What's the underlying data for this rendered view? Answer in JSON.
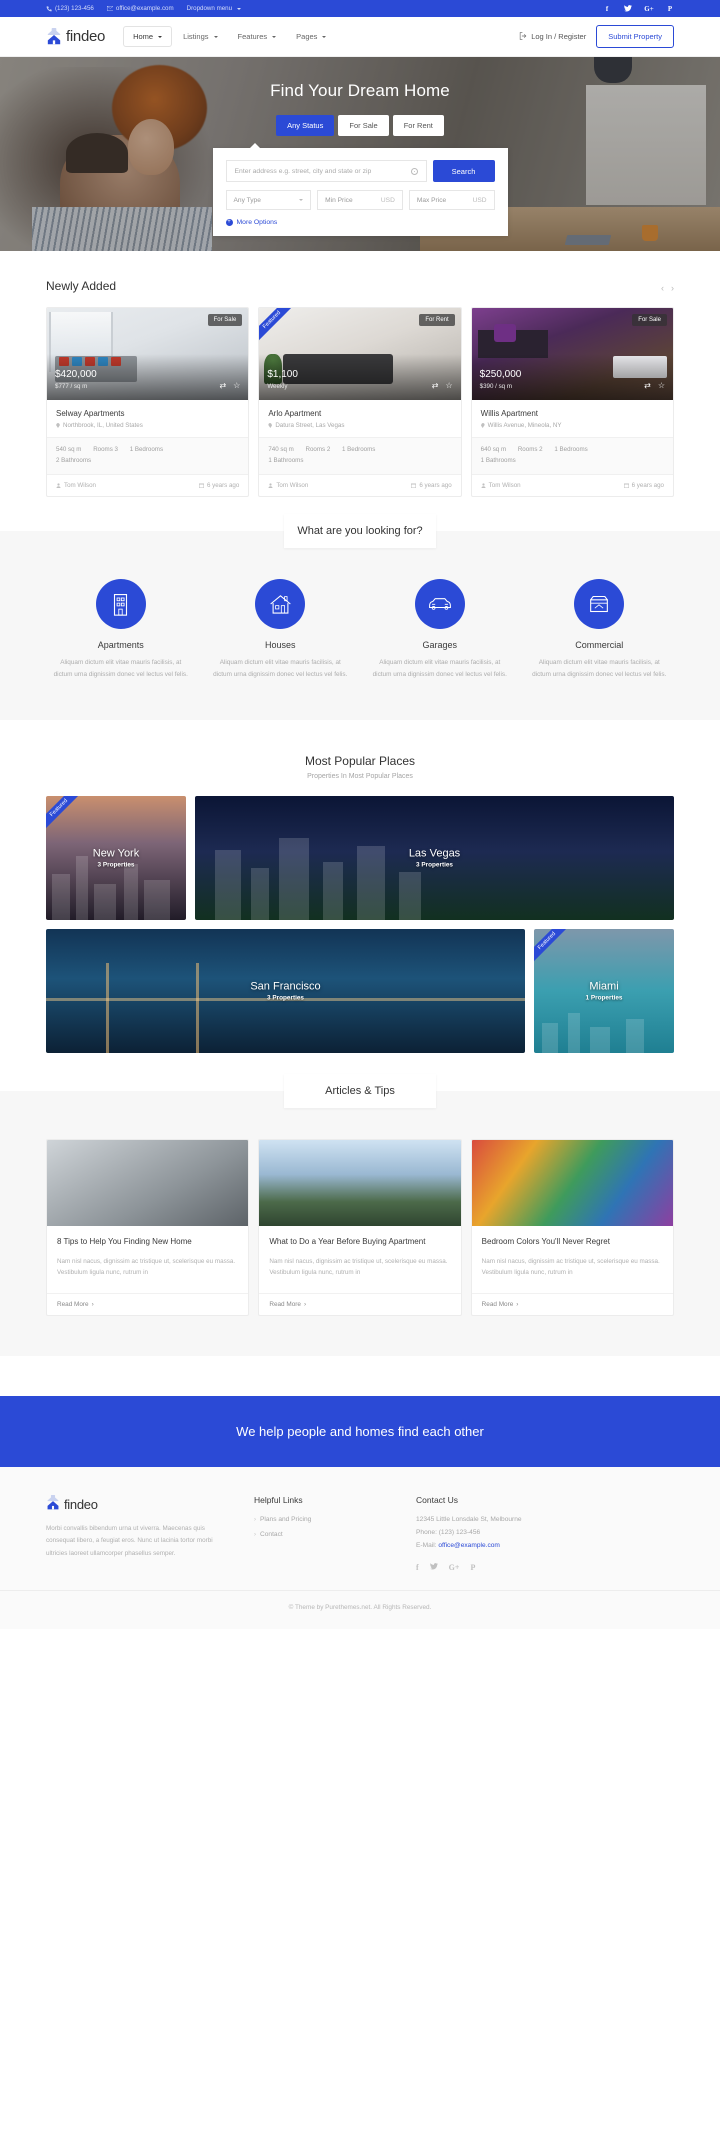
{
  "topbar": {
    "phone": "(123) 123-456",
    "email": "office@example.com",
    "dropdown": "Dropdown menu",
    "socials": [
      "facebook-icon",
      "twitter-icon",
      "google-plus-icon",
      "pinterest-icon"
    ]
  },
  "header": {
    "brand": "findeo",
    "nav": [
      {
        "label": "Home",
        "active": true
      },
      {
        "label": "Listings",
        "active": false
      },
      {
        "label": "Features",
        "active": false
      },
      {
        "label": "Pages",
        "active": false
      }
    ],
    "login": "Log In / Register",
    "submit": "Submit Property"
  },
  "hero": {
    "title": "Find Your Dream Home",
    "status_tabs": [
      {
        "label": "Any Status",
        "active": true
      },
      {
        "label": "For Sale",
        "active": false
      },
      {
        "label": "For Rent",
        "active": false
      }
    ],
    "search": {
      "placeholder": "Enter address e.g. street, city and state or zip",
      "value": "",
      "button": "Search",
      "type_select": "Any Type",
      "min_price": "Min Price",
      "min_unit": "USD",
      "max_price": "Max Price",
      "max_unit": "USD",
      "more_options": "More Options"
    }
  },
  "newly_added": {
    "title": "Newly Added",
    "properties": [
      {
        "name": "Selway Apartments",
        "address": "Northbrook, IL, United States",
        "price": "$420,000",
        "unit": "$777 / sq m",
        "badge": "For Sale",
        "ribbon": "",
        "area": "540 sq m",
        "rooms": "Rooms 3",
        "bedrooms": "1 Bedrooms",
        "bathrooms": "2 Bathrooms",
        "agent": "Tom Wilson",
        "date": "6 years ago"
      },
      {
        "name": "Arlo Apartment",
        "address": "Datura Street, Las Vegas",
        "price": "$1,100",
        "unit": "Weekly",
        "badge": "For Rent",
        "ribbon": "Featured",
        "area": "740 sq m",
        "rooms": "Rooms 2",
        "bedrooms": "1 Bedrooms",
        "bathrooms": "1 Bathrooms",
        "agent": "Tom Wilson",
        "date": "6 years ago"
      },
      {
        "name": "Willis Apartment",
        "address": "Willis Avenue, Mineola, NY",
        "price": "$250,000",
        "unit": "$390 / sq m",
        "badge": "For Sale",
        "ribbon": "",
        "area": "640 sq m",
        "rooms": "Rooms 2",
        "bedrooms": "1 Bedrooms",
        "bathrooms": "1 Bathrooms",
        "agent": "Tom Wilson",
        "date": "6 years ago"
      }
    ]
  },
  "categories": {
    "title": "What are you looking for?",
    "items": [
      {
        "name": "Apartments",
        "icon": "apartment-building-icon",
        "desc": "Aliquam dictum elit vitae mauris facilisis, at dictum urna dignissim donec vel lectus vel felis."
      },
      {
        "name": "Houses",
        "icon": "house-icon",
        "desc": "Aliquam dictum elit vitae mauris facilisis, at dictum urna dignissim donec vel lectus vel felis."
      },
      {
        "name": "Garages",
        "icon": "car-icon",
        "desc": "Aliquam dictum elit vitae mauris facilisis, at dictum urna dignissim donec vel lectus vel felis."
      },
      {
        "name": "Commercial",
        "icon": "store-icon",
        "desc": "Aliquam dictum elit vitae mauris facilisis, at dictum urna dignissim donec vel lectus vel felis."
      }
    ]
  },
  "places": {
    "title": "Most Popular Places",
    "subtitle": "Properties In Most Popular Places",
    "items": [
      {
        "name": "New York",
        "count": "3 Properties",
        "ribbon": "Featured"
      },
      {
        "name": "Las Vegas",
        "count": "3 Properties",
        "ribbon": ""
      },
      {
        "name": "San Francisco",
        "count": "3 Properties",
        "ribbon": ""
      },
      {
        "name": "Miami",
        "count": "1 Properties",
        "ribbon": "Featured"
      }
    ]
  },
  "articles": {
    "title": "Articles & Tips",
    "items": [
      {
        "title": "8 Tips to Help You Finding New Home",
        "desc": "Nam nisl nacus, dignissim ac tristique ut, scelerisque eu massa. Vestibulum ligula nunc, rutrum in",
        "more": "Read More"
      },
      {
        "title": "What to Do a Year Before Buying Apartment",
        "desc": "Nam nisl nacus, dignissim ac tristique ut, scelerisque eu massa. Vestibulum ligula nunc, rutrum in",
        "more": "Read More"
      },
      {
        "title": "Bedroom Colors You'll Never Regret",
        "desc": "Nam nisl nacus, dignissim ac tristique ut, scelerisque eu massa. Vestibulum ligula nunc, rutrum in",
        "more": "Read More"
      }
    ]
  },
  "cta": {
    "text": "We help people and homes find each other"
  },
  "footer": {
    "brand": "findeo",
    "desc": "Morbi convallis bibendum urna ut viverra. Maecenas quis consequat libero, a feugiat eros. Nunc ut lacinia tortor morbi ultricies laoreet ullamcorper phasellus semper.",
    "helpful_title": "Helpful Links",
    "helpful_links": [
      "Plans and Pricing",
      "Contact"
    ],
    "contact_title": "Contact Us",
    "address": "12345 Little Lonsdale St, Melbourne",
    "phone": "Phone: (123) 123-456",
    "email_label": "E-Mail:",
    "email": "office@example.com",
    "socials": [
      "facebook-icon",
      "twitter-icon",
      "google-plus-icon",
      "pinterest-icon"
    ],
    "copyright": "© Theme by Purethemes.net. All Rights Reserved."
  },
  "colors": {
    "brand": "#2b4ad6",
    "dark": "#333333",
    "muted": "#a8a8a8"
  }
}
